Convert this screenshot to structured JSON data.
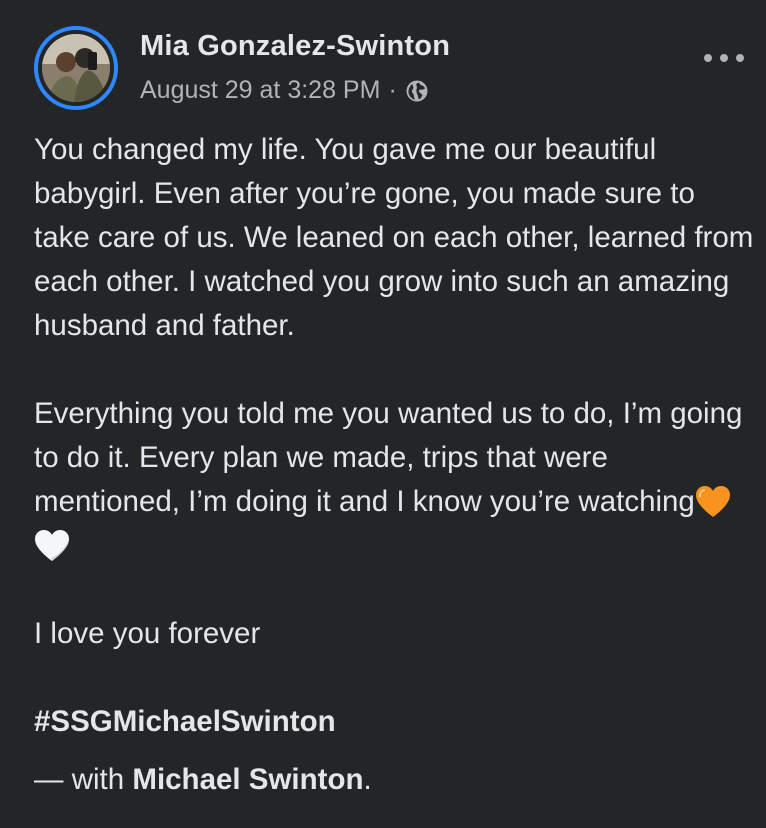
{
  "post": {
    "author": "Mia Gonzalez-Swinton",
    "date": "August 29 at 3:28 PM",
    "separator": "·",
    "privacy_icon": "globe-icon",
    "more_icon": "more-options-icon",
    "ring_color": "#2d88ff",
    "paragraphs": [
      "You changed my life. You gave me our beautiful babygirl. Even after you’re gone, you made sure to take care of us. We leaned on each other, learned from each other. I watched you grow into such an amazing husband and father.",
      "Everything you told me you wanted us to do, I’m going to do it. Every plan we made, trips that were mentioned, I’m doing it and I know you’re watching",
      "I love you forever"
    ],
    "emojis": [
      "orange-heart-emoji",
      "white-heart-emoji"
    ],
    "hashtag": "#SSGMichaelSwinton",
    "with_prefix": "— with",
    "tagged_person": "Michael Swinton",
    "with_suffix": "."
  }
}
